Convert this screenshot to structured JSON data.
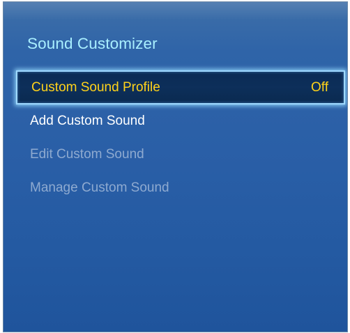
{
  "panel": {
    "title": "Sound Customizer"
  },
  "menu": {
    "items": [
      {
        "label": "Custom Sound Profile",
        "value": "Off",
        "state": "selected"
      },
      {
        "label": "Add Custom Sound",
        "state": "enabled"
      },
      {
        "label": "Edit Custom Sound",
        "state": "disabled"
      },
      {
        "label": "Manage Custom Sound",
        "state": "disabled"
      }
    ]
  },
  "colors": {
    "panel_background": "#2a5fa7",
    "title_text": "#a9efff",
    "selected_text": "#ffd21a",
    "selected_background": "#0c2d57",
    "selected_border": "#9fd9ff",
    "enabled_text": "#ffffff",
    "disabled_text": "#8eaad0"
  }
}
